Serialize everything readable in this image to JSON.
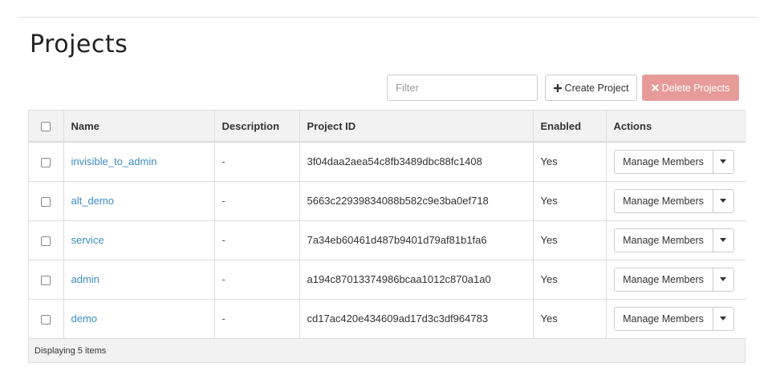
{
  "page": {
    "title": "Projects"
  },
  "toolbar": {
    "filter_placeholder": "Filter",
    "create_label": "Create Project",
    "delete_label": "Delete Projects"
  },
  "table": {
    "columns": [
      "Name",
      "Description",
      "Project ID",
      "Enabled",
      "Actions"
    ],
    "rows": [
      {
        "name": "invisible_to_admin",
        "description": "-",
        "project_id": "3f04daa2aea54c8fb3489dbc88fc1408",
        "enabled": "Yes",
        "action": "Manage Members"
      },
      {
        "name": "alt_demo",
        "description": "-",
        "project_id": "5663c22939834088b582c9e3ba0ef718",
        "enabled": "Yes",
        "action": "Manage Members"
      },
      {
        "name": "service",
        "description": "-",
        "project_id": "7a34eb60461d487b9401d79af81b1fa6",
        "enabled": "Yes",
        "action": "Manage Members"
      },
      {
        "name": "admin",
        "description": "-",
        "project_id": "a194c87013374986bcaa1012c870a1a0",
        "enabled": "Yes",
        "action": "Manage Members"
      },
      {
        "name": "demo",
        "description": "-",
        "project_id": "cd17ac420e434609ad17d3c3df964783",
        "enabled": "Yes",
        "action": "Manage Members"
      }
    ],
    "footer": "Displaying 5 items"
  },
  "icons": {
    "search": "search-icon",
    "plus": "plus-icon",
    "delete": "times-icon",
    "caret": "caret-down-icon"
  },
  "colors": {
    "link": "#3c8dc4",
    "delete_bg": "#e79b99",
    "header_bg": "#f2f2f2"
  }
}
